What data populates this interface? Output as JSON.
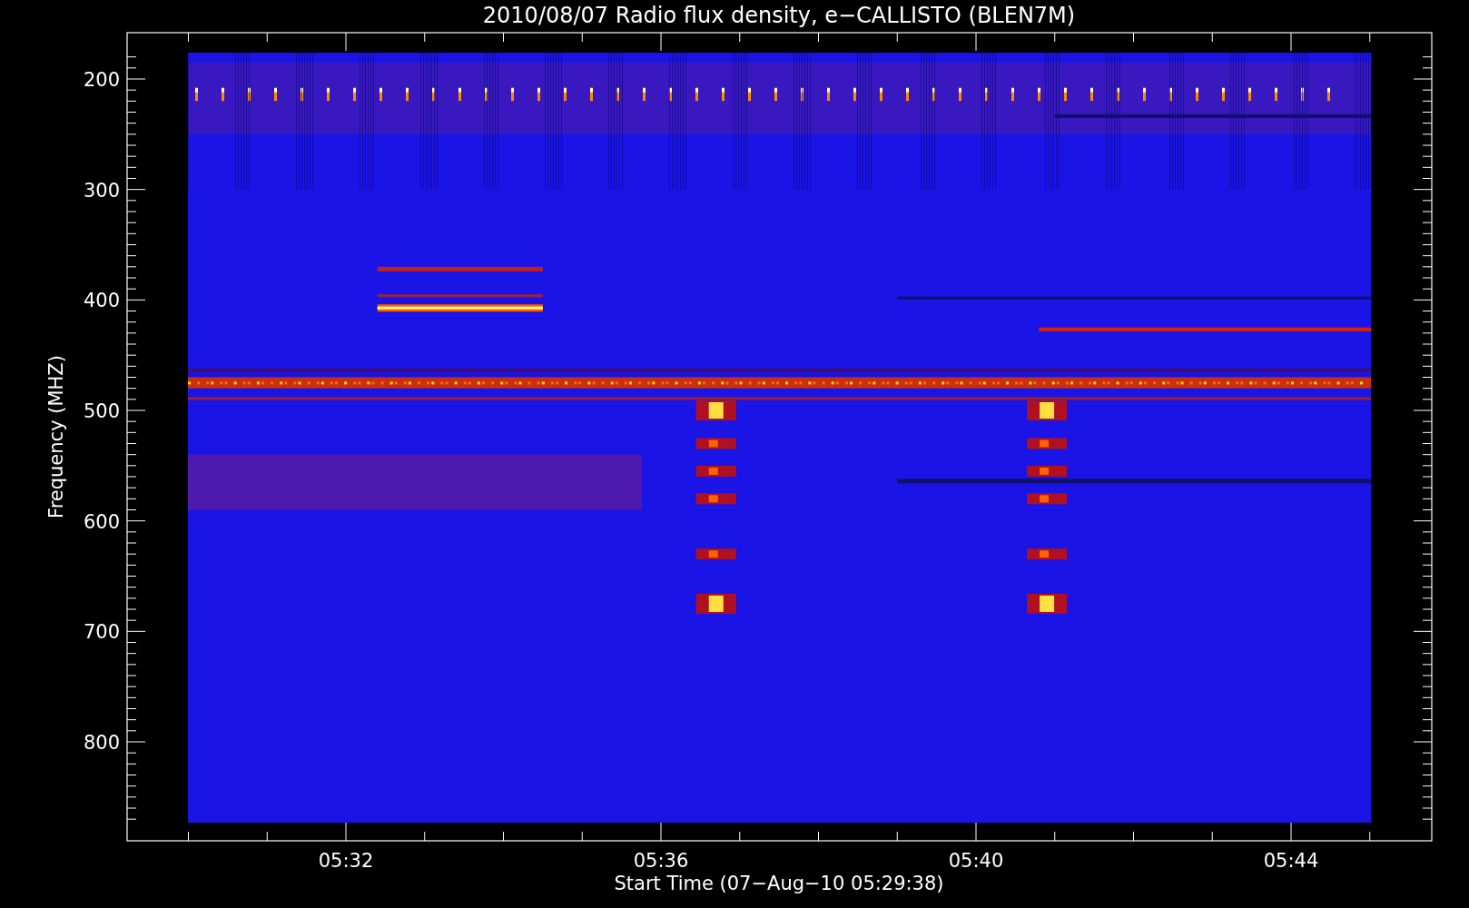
{
  "title": "2010/08/07  Radio flux density, e−CALLISTO (BLEN7M)",
  "y_axis": {
    "label": "Frequency (MHZ)",
    "ticks": [
      "200",
      "300",
      "400",
      "500",
      "600",
      "700",
      "800"
    ]
  },
  "x_axis": {
    "label": "Start Time (07−Aug−10 05:29:38)",
    "ticks": [
      "05:32",
      "05:36",
      "05:40",
      "05:44"
    ]
  }
}
